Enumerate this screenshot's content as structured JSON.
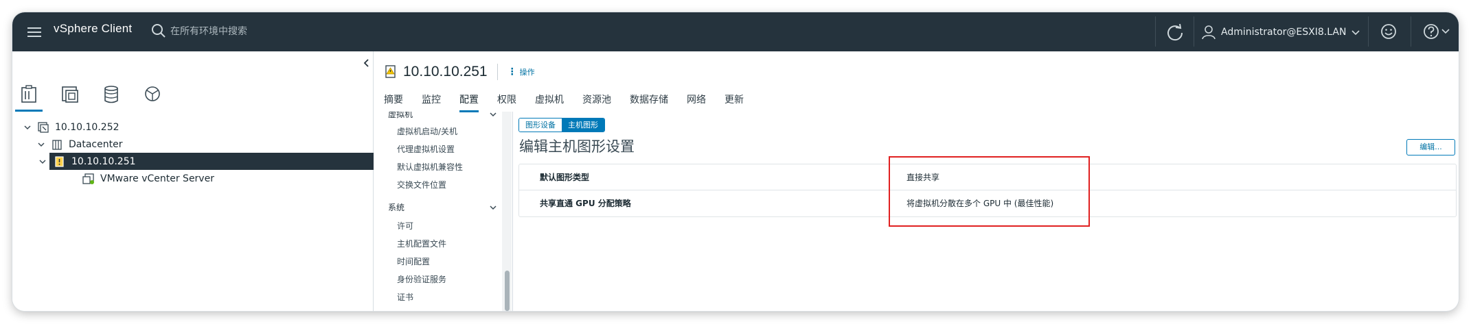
{
  "header": {
    "app_title": "vSphere Client",
    "search_placeholder": "在所有环境中搜索",
    "user": "Administrator@ESXI8.LAN"
  },
  "tree": {
    "nodes": [
      {
        "label": "10.10.10.252",
        "icon": "vcenter-icon",
        "expanded": true
      },
      {
        "label": "Datacenter",
        "icon": "datacenter-icon",
        "expanded": true
      },
      {
        "label": "10.10.10.251",
        "icon": "host-warning-icon",
        "expanded": true,
        "selected": true
      },
      {
        "label": "VMware vCenter Server",
        "icon": "vm-icon"
      }
    ]
  },
  "object": {
    "title": "10.10.10.251",
    "actions_label": "操作"
  },
  "tabs": [
    "摘要",
    "监控",
    "配置",
    "权限",
    "虚拟机",
    "资源池",
    "数据存储",
    "网络",
    "更新"
  ],
  "active_tab": "配置",
  "settings_nav": {
    "vm_section": "虚拟机",
    "vm_items": [
      "虚拟机启动/关机",
      "代理虚拟机设置",
      "默认虚拟机兼容性",
      "交换文件位置"
    ],
    "system_section": "系统",
    "system_items": [
      "许可",
      "主机配置文件",
      "时间配置",
      "身份验证服务",
      "证书"
    ]
  },
  "graphics": {
    "segments": [
      "图形设备",
      "主机图形"
    ],
    "active_segment": "主机图形",
    "title": "编辑主机图形设置",
    "edit_label": "编辑...",
    "rows": [
      {
        "name": "默认图形类型",
        "value": "直接共享"
      },
      {
        "name": "共享直通 GPU 分配策略",
        "value": "将虚拟机分散在多个 GPU 中 (最佳性能)"
      }
    ]
  },
  "colors": {
    "header_bg": "#25333d",
    "accent": "#0079b8",
    "highlight": "#e02020"
  }
}
